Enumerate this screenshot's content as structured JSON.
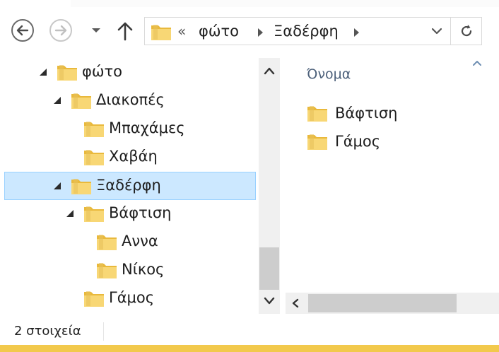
{
  "address_bar": {
    "overflow": "«",
    "crumbs": [
      "φώτο",
      "Ξαδέρφη"
    ]
  },
  "nav_tree": [
    {
      "label": "φώτο",
      "level": 0,
      "expanded": true
    },
    {
      "label": "Διακοπές",
      "level": 1,
      "expanded": true
    },
    {
      "label": "Μπαχάμες",
      "level": 2,
      "expanded": false
    },
    {
      "label": "Χαβάη",
      "level": 2,
      "expanded": false
    },
    {
      "label": "Ξαδέρφη",
      "level": 1,
      "expanded": true,
      "selected": true
    },
    {
      "label": "Βάφτιση",
      "level": 2,
      "expanded": true
    },
    {
      "label": "Αννα",
      "level": 3,
      "expanded": false
    },
    {
      "label": "Νίκος",
      "level": 3,
      "expanded": false
    },
    {
      "label": "Γάμος",
      "level": 2,
      "expanded": false
    }
  ],
  "content": {
    "column_header": "Όνομα",
    "items": [
      "Βάφτιση",
      "Γάμος"
    ]
  },
  "status": {
    "item_count": "2 στοιχεία"
  },
  "colors": {
    "selection_bg": "#cce8ff",
    "selection_border": "#99d1ff",
    "folder_yellow": "#f8d775",
    "accent_bar": "#f2c94c"
  },
  "icons": {
    "back": "back-arrow-icon",
    "forward": "forward-arrow-icon",
    "recent": "chevron-down-icon",
    "up": "up-arrow-icon",
    "refresh": "refresh-icon",
    "folder": "folder-icon"
  }
}
